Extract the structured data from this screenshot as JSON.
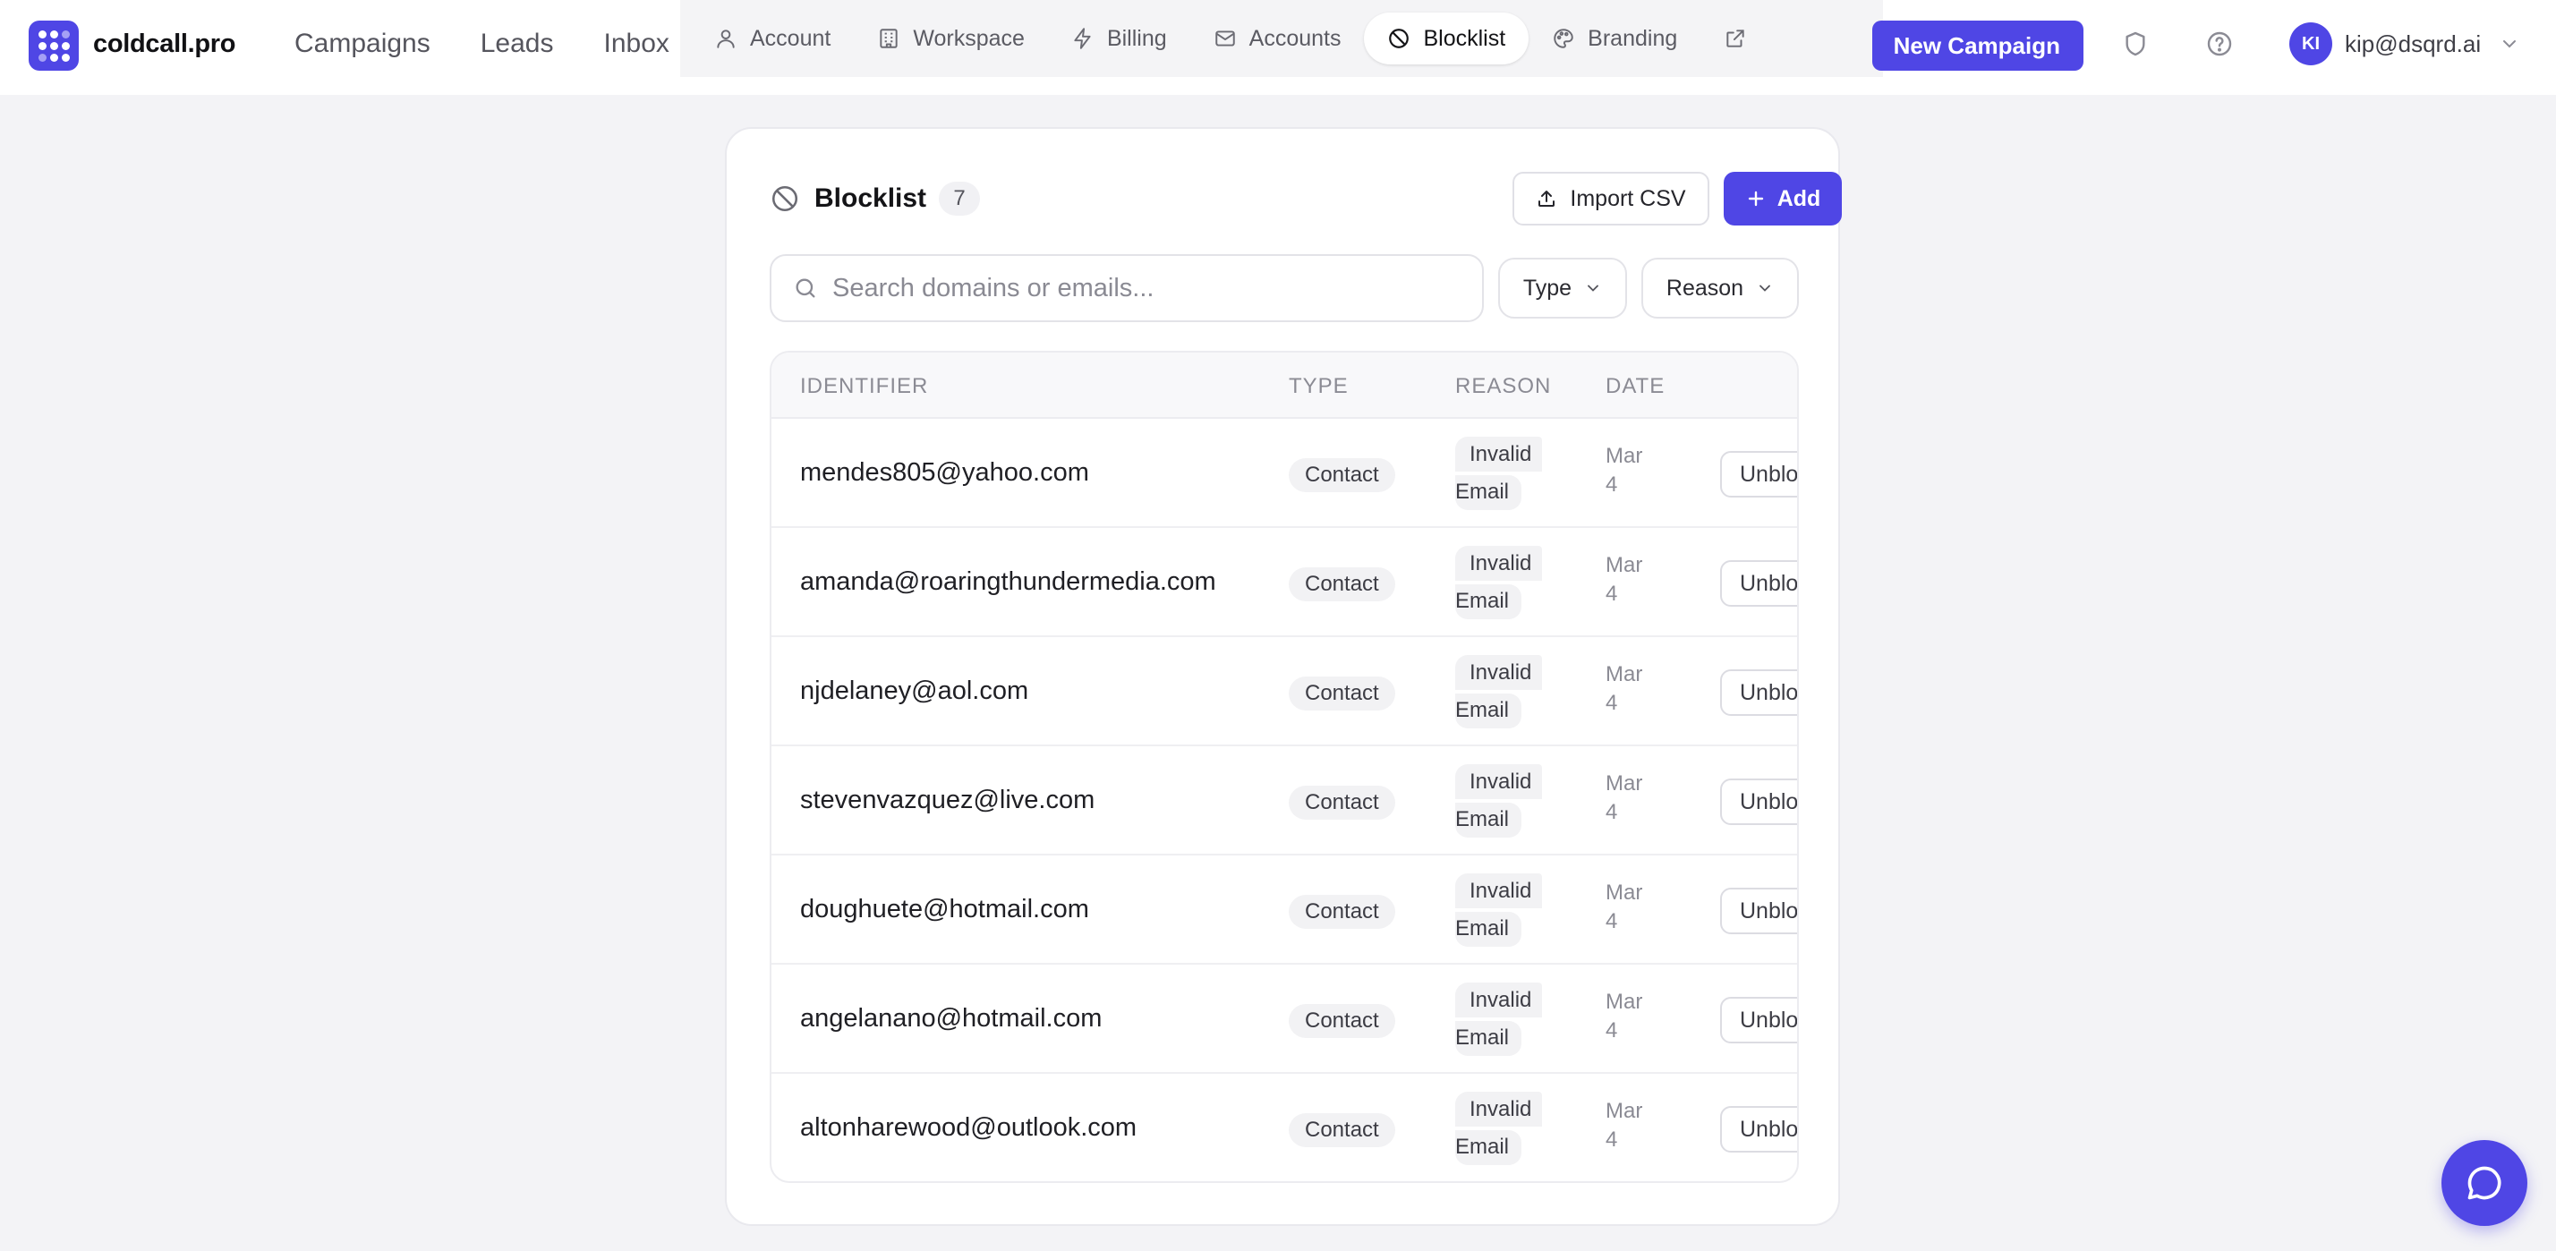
{
  "app": {
    "brand": "coldcall.pro",
    "main_nav": [
      "Campaigns",
      "Leads",
      "Inbox"
    ],
    "new_campaign_label": "New Campaign",
    "user_initials": "KI",
    "user_email": "kip@dsqrd.ai",
    "accent_color": "#4f46e5"
  },
  "settings_tabs": [
    {
      "label": "Account",
      "icon": "user-icon"
    },
    {
      "label": "Workspace",
      "icon": "building-icon"
    },
    {
      "label": "Billing",
      "icon": "bolt-icon"
    },
    {
      "label": "Accounts",
      "icon": "mail-icon"
    },
    {
      "label": "Blocklist",
      "icon": "ban-icon",
      "active": true
    },
    {
      "label": "Branding",
      "icon": "palette-icon"
    },
    {
      "label": "",
      "icon": "external-link-icon"
    }
  ],
  "blocklist": {
    "title": "Blocklist",
    "count": "7",
    "import_label": "Import CSV",
    "add_label": "Add",
    "search_placeholder": "Search domains or emails...",
    "filters": {
      "type": "Type",
      "reason": "Reason"
    },
    "columns": {
      "identifier": "IDENTIFIER",
      "type": "TYPE",
      "reason": "REASON",
      "date": "DATE"
    },
    "rows": [
      {
        "identifier": "mendes805@yahoo.com",
        "type": "Contact",
        "reason_l1": "Invalid",
        "reason_l2": "Email",
        "date_l1": "Mar",
        "date_l2": "4",
        "action": "Unblock"
      },
      {
        "identifier": "amanda@roaringthundermedia.com",
        "type": "Contact",
        "reason_l1": "Invalid",
        "reason_l2": "Email",
        "date_l1": "Mar",
        "date_l2": "4",
        "action": "Unblock"
      },
      {
        "identifier": "njdelaney@aol.com",
        "type": "Contact",
        "reason_l1": "Invalid",
        "reason_l2": "Email",
        "date_l1": "Mar",
        "date_l2": "4",
        "action": "Unblock"
      },
      {
        "identifier": "stevenvazquez@live.com",
        "type": "Contact",
        "reason_l1": "Invalid",
        "reason_l2": "Email",
        "date_l1": "Mar",
        "date_l2": "4",
        "action": "Unblock"
      },
      {
        "identifier": "doughuete@hotmail.com",
        "type": "Contact",
        "reason_l1": "Invalid",
        "reason_l2": "Email",
        "date_l1": "Mar",
        "date_l2": "4",
        "action": "Unblock"
      },
      {
        "identifier": "angelanano@hotmail.com",
        "type": "Contact",
        "reason_l1": "Invalid",
        "reason_l2": "Email",
        "date_l1": "Mar",
        "date_l2": "4",
        "action": "Unblock"
      },
      {
        "identifier": "altonharewood@outlook.com",
        "type": "Contact",
        "reason_l1": "Invalid",
        "reason_l2": "Email",
        "date_l1": "Mar",
        "date_l2": "4",
        "action": "Unblock"
      }
    ]
  }
}
